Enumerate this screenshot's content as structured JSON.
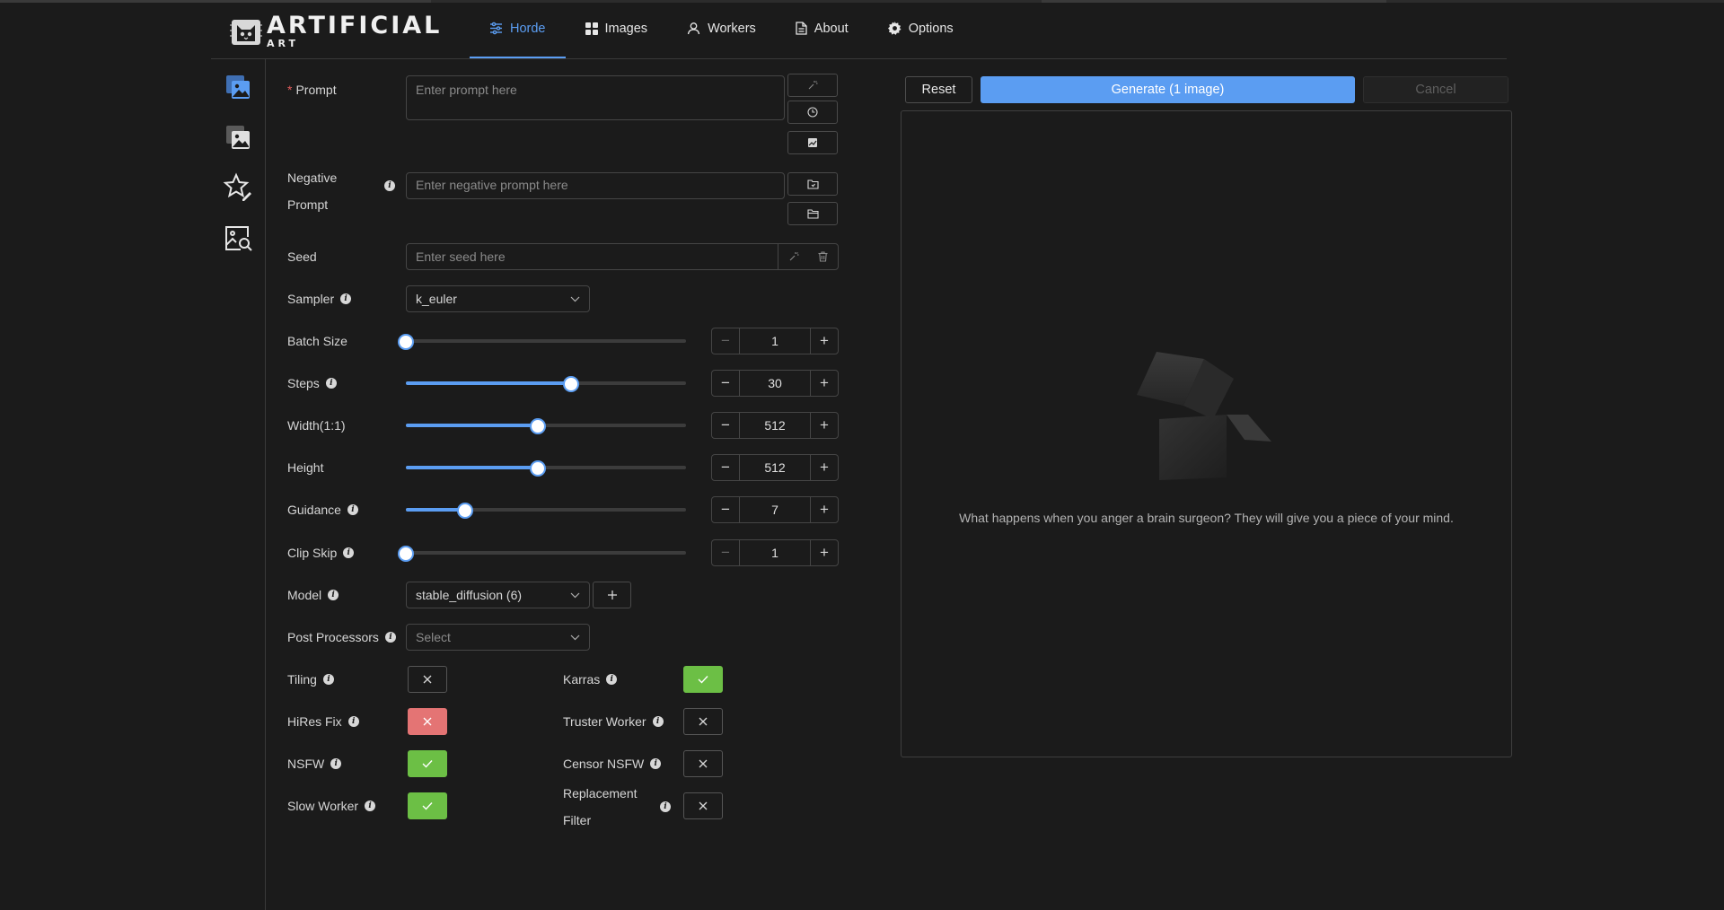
{
  "app": {
    "logo_main": "ARTIFICIAL",
    "logo_sub": "ART"
  },
  "nav": {
    "items": [
      {
        "label": "Horde",
        "icon": "sliders-icon",
        "active": true
      },
      {
        "label": "Images",
        "icon": "grid-icon",
        "active": false
      },
      {
        "label": "Workers",
        "icon": "user-icon",
        "active": false
      },
      {
        "label": "About",
        "icon": "document-icon",
        "active": false
      },
      {
        "label": "Options",
        "icon": "gear-icon",
        "active": false
      }
    ]
  },
  "sidebar": {
    "items": [
      "image-generate-icon",
      "image-to-image-icon",
      "star-edit-icon",
      "image-search-icon"
    ]
  },
  "form": {
    "prompt": {
      "label": "Prompt",
      "required_mark": "*",
      "placeholder": "Enter prompt here"
    },
    "negative_prompt": {
      "label_line1": "Negative",
      "label_line2": "Prompt",
      "placeholder": "Enter negative prompt here"
    },
    "seed": {
      "label": "Seed",
      "placeholder": "Enter seed here"
    },
    "sampler": {
      "label": "Sampler",
      "value": "k_euler"
    },
    "sliders": [
      {
        "label": "Batch Size",
        "info": false,
        "value": "1",
        "fraction": 0.0,
        "minus_disabled": true
      },
      {
        "label": "Steps",
        "info": true,
        "value": "30",
        "fraction": 0.59,
        "minus_disabled": false
      },
      {
        "label": "Width(1:1)",
        "info": false,
        "value": "512",
        "fraction": 0.47,
        "minus_disabled": false
      },
      {
        "label": "Height",
        "info": false,
        "value": "512",
        "fraction": 0.47,
        "minus_disabled": false
      },
      {
        "label": "Guidance",
        "info": true,
        "value": "7",
        "fraction": 0.21,
        "minus_disabled": false
      },
      {
        "label": "Clip Skip",
        "info": true,
        "value": "1",
        "fraction": 0.0,
        "minus_disabled": true
      }
    ],
    "model": {
      "label": "Model",
      "value": "stable_diffusion (6)"
    },
    "post_processors": {
      "label": "Post Processors",
      "placeholder": "Select"
    },
    "toggles_left": [
      {
        "label": "Tiling",
        "state": "off"
      },
      {
        "label": "HiRes Fix",
        "state": "error"
      },
      {
        "label": "NSFW",
        "state": "on"
      },
      {
        "label": "Slow Worker",
        "state": "on"
      }
    ],
    "toggles_right": [
      {
        "label": "Karras",
        "state": "on"
      },
      {
        "label": "Truster Worker",
        "state": "off"
      },
      {
        "label": "Censor NSFW",
        "state": "off"
      },
      {
        "label_line1": "Replacement",
        "label_line2": "Filter",
        "state": "off"
      }
    ]
  },
  "actions": {
    "reset": "Reset",
    "generate": "Generate (1 image)",
    "cancel": "Cancel"
  },
  "preview": {
    "joke": "What happens when you anger a brain surgeon? They will give you a piece of your mind."
  },
  "colors": {
    "accent": "#5b9df2",
    "on": "#6cbf45",
    "error": "#e47474",
    "background": "#1b1b1b"
  }
}
